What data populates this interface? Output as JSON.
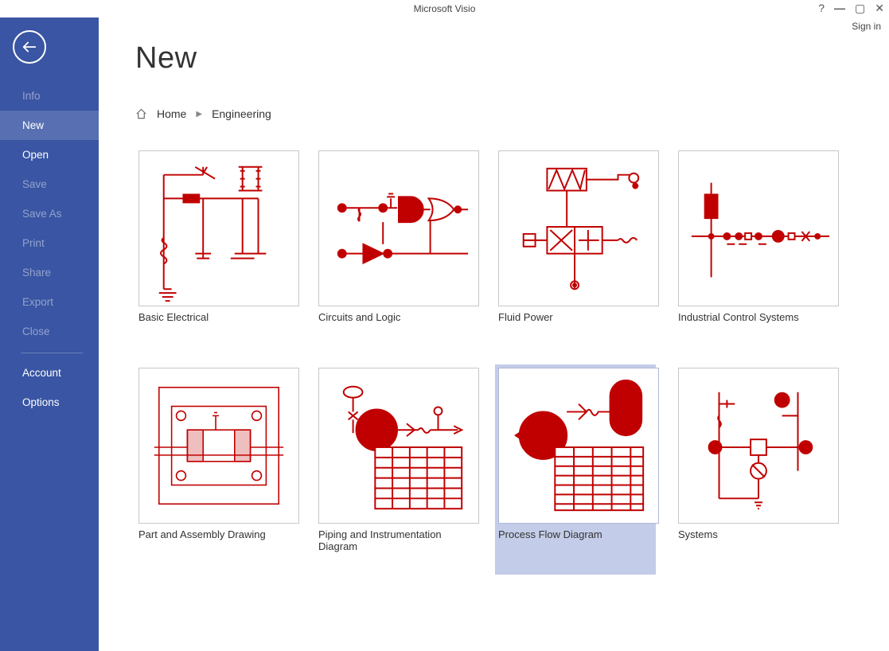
{
  "app_title": "Microsoft Visio",
  "sign_in_label": "Sign in",
  "sidebar": {
    "items": [
      {
        "label": "Info",
        "dim": true,
        "active": false
      },
      {
        "label": "New",
        "dim": false,
        "active": true
      },
      {
        "label": "Open",
        "dim": false,
        "active": false
      },
      {
        "label": "Save",
        "dim": true,
        "active": false
      },
      {
        "label": "Save As",
        "dim": true,
        "active": false
      },
      {
        "label": "Print",
        "dim": true,
        "active": false
      },
      {
        "label": "Share",
        "dim": true,
        "active": false
      },
      {
        "label": "Export",
        "dim": true,
        "active": false
      },
      {
        "label": "Close",
        "dim": true,
        "active": false
      }
    ],
    "bottom_items": [
      {
        "label": "Account"
      },
      {
        "label": "Options"
      }
    ]
  },
  "page": {
    "title": "New",
    "breadcrumb": [
      "Home",
      "Engineering"
    ]
  },
  "templates": [
    {
      "label": "Basic Electrical",
      "selected": false
    },
    {
      "label": "Circuits and Logic",
      "selected": false
    },
    {
      "label": "Fluid Power",
      "selected": false
    },
    {
      "label": "Industrial Control Systems",
      "selected": false
    },
    {
      "label": "Part and Assembly Drawing",
      "selected": false
    },
    {
      "label": "Piping and Instrumentation Diagram",
      "selected": false
    },
    {
      "label": "Process Flow Diagram",
      "selected": true
    },
    {
      "label": "Systems",
      "selected": false
    }
  ]
}
